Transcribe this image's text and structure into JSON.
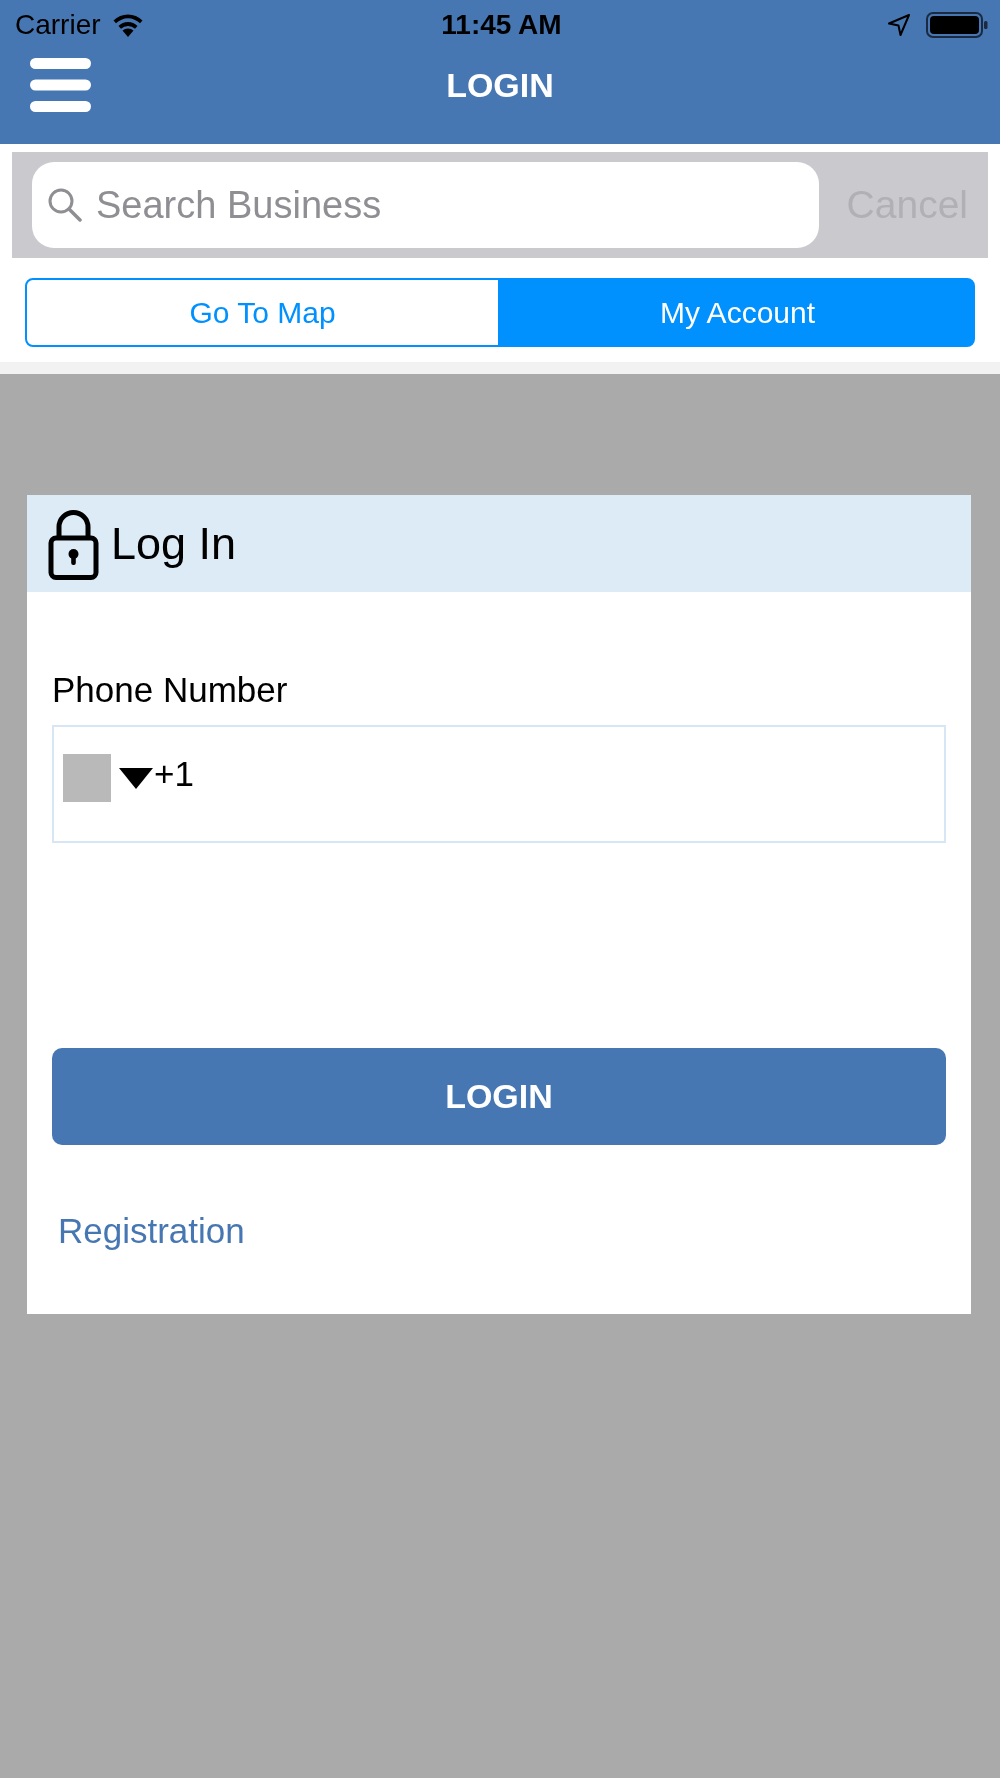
{
  "status_bar": {
    "carrier": "Carrier",
    "time": "11:45 AM"
  },
  "nav_bar": {
    "title": "LOGIN"
  },
  "search": {
    "placeholder": "Search Business",
    "cancel": {
      "label": "Cancel",
      "disabled": true
    }
  },
  "segments": [
    {
      "label": "Go To Map",
      "selected": false
    },
    {
      "label": "My Account",
      "selected": true
    }
  ],
  "login_card": {
    "title": "Log In",
    "phone_label": "Phone Number",
    "country_code": "+1",
    "button": "LOGIN",
    "link": "Registration"
  }
}
